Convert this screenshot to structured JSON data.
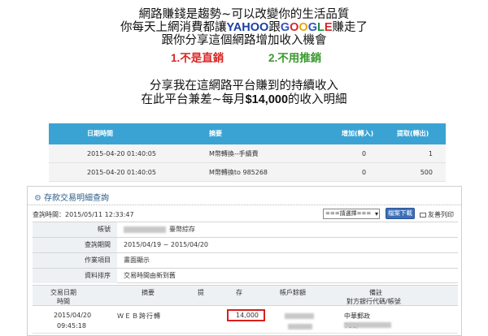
{
  "promo": {
    "line1": "網路賺錢是趨勢~可以改變你的生活品質",
    "line2_prefix": "你每天上網消費都讓",
    "yahoo": "YAHOO",
    "line2_mid": "跟",
    "google": [
      "G",
      "O",
      "O",
      "G",
      "L",
      "E"
    ],
    "line2_suffix": "賺走了",
    "line3": "跟你分享這個網路增加收入機會",
    "reason1": "1.不是直銷",
    "reason2": "2.不用推銷",
    "income_line1": "分享我在這網路平台賺到的持續收入",
    "income_line2_prefix": "在此平台兼差~每月",
    "income_amount": "$14,000",
    "income_line2_suffix": "的收入明細"
  },
  "earnings": {
    "headers": [
      "日期時間",
      "摘要",
      "增加(轉入)",
      "提取(轉出)"
    ],
    "rows": [
      {
        "date": "2015-04-20 01:40:05",
        "summary": "M幣轉換--手續費",
        "add": "0",
        "withdraw": "1"
      },
      {
        "date": "2015-04-20 01:40:05",
        "summary": "M幣轉換to 985268",
        "add": "0",
        "withdraw": "500"
      }
    ]
  },
  "bank": {
    "title": "存款交易明細查詢",
    "query_time": "查詢時間：2015/05/11 12:33:47",
    "select_value": "===請選擇===",
    "download_label": "檔案下載",
    "print_label": "友善列印",
    "info": [
      {
        "label": "帳號",
        "value": "臺幣綜存",
        "masked": true
      },
      {
        "label": "查詢期間",
        "value": "2015/04/19 ~ 2015/04/20"
      },
      {
        "label": "作業項目",
        "value": "畫面顯示"
      },
      {
        "label": "資料排序",
        "value": "交易時間由新到舊"
      }
    ],
    "tx_headers": {
      "date": "交易日期",
      "time": "時間",
      "summary": "摘要",
      "withdraw": "提",
      "deposit": "存",
      "balance": "帳戶餘額",
      "note": "備註",
      "note_sub": "對方銀行代碼/帳號"
    },
    "tx_rows": [
      {
        "date": "2015/04/20",
        "time": "09:45:18",
        "summary": "ＷＥＢ跨行轉",
        "deposit": "14,000",
        "note": "中華郵政",
        "note_sub": "700/"
      }
    ]
  },
  "colors": {
    "earnings_header": "#3aa3d4",
    "highlight_box": "#d91e1e",
    "reason1": "#d92525",
    "reason2": "#3a9a2e"
  }
}
